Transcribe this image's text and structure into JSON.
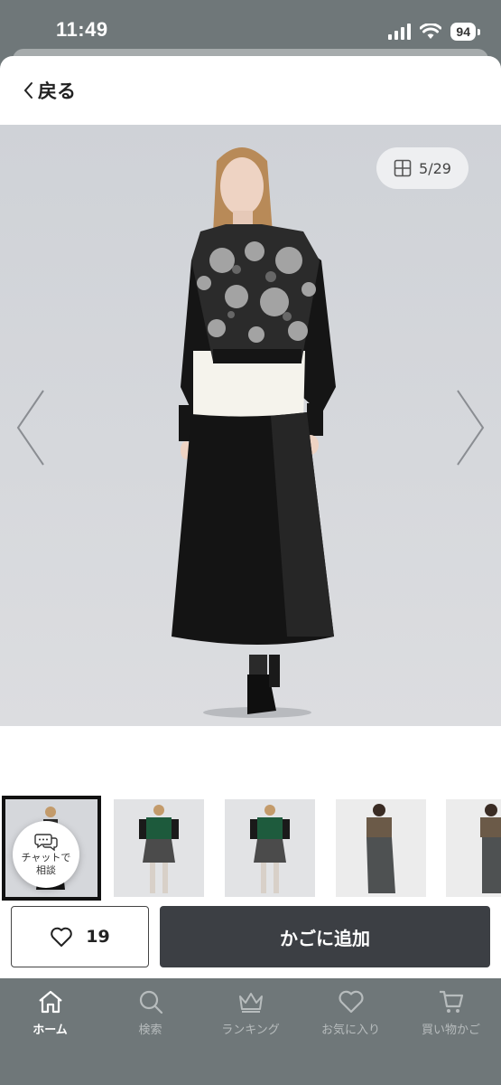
{
  "status_bar": {
    "time": "11:49",
    "battery": "94"
  },
  "header": {
    "back_label": "戻る"
  },
  "gallery": {
    "counter": "5/29"
  },
  "chat": {
    "label": "チャットで\n相談"
  },
  "actions": {
    "favorite_count": "19",
    "add_to_cart": "かごに追加"
  },
  "tabs": [
    {
      "label": "ホーム",
      "icon": "home-icon",
      "active": true
    },
    {
      "label": "検索",
      "icon": "search-icon",
      "active": false
    },
    {
      "label": "ランキング",
      "icon": "crown-icon",
      "active": false
    },
    {
      "label": "お気に入り",
      "icon": "heart-icon",
      "active": false
    },
    {
      "label": "買い物かご",
      "icon": "cart-icon",
      "active": false
    }
  ],
  "colors": {
    "accent_dark": "#3c3f44",
    "tabbar": "#6f7779"
  }
}
